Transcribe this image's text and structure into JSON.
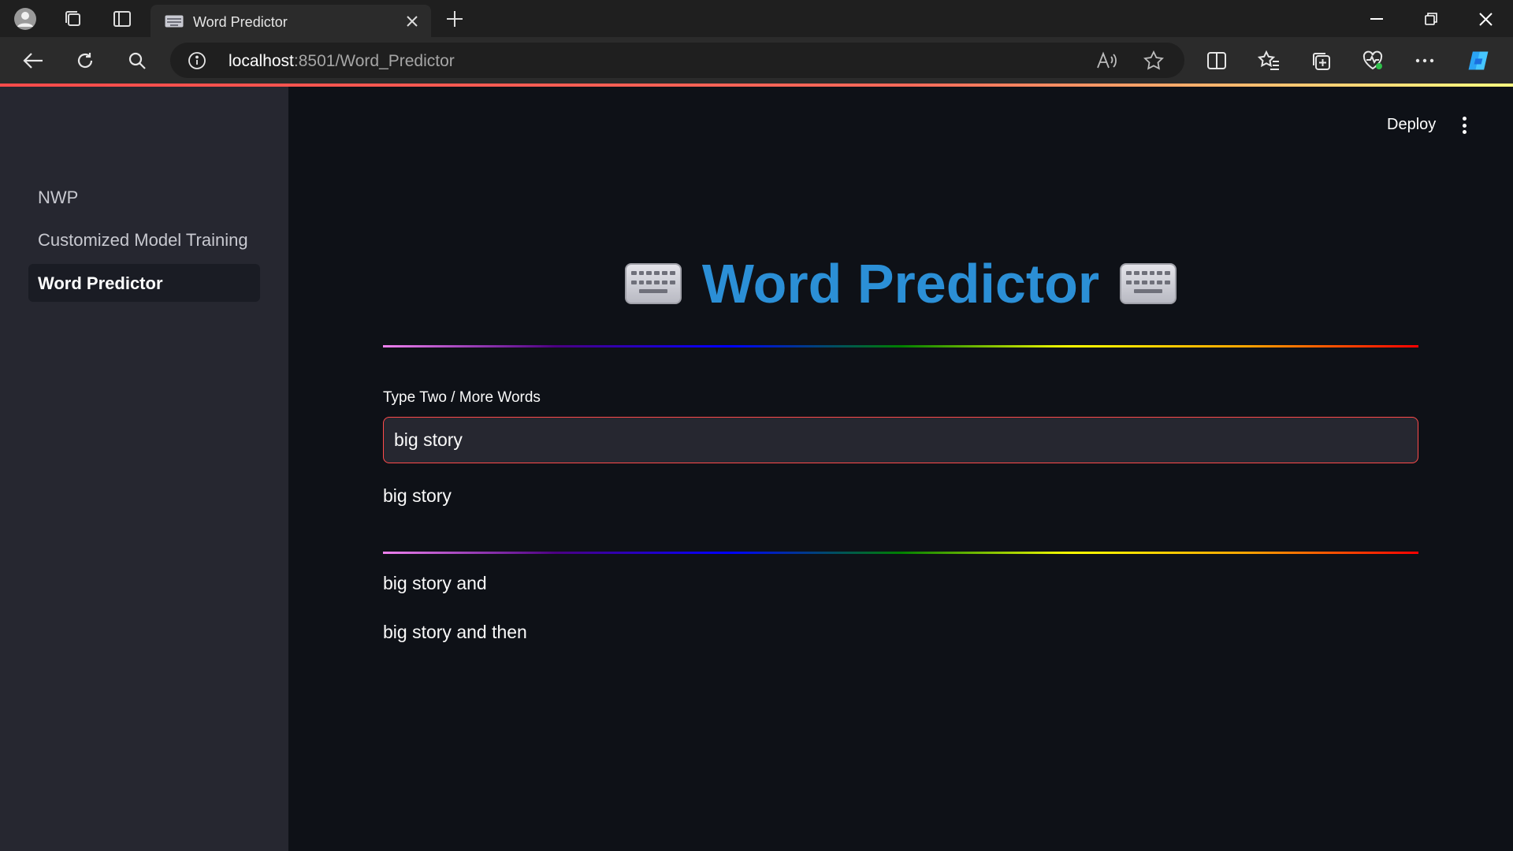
{
  "browser": {
    "tab_title": "Word Predictor",
    "url_host": "localhost",
    "url_rest": ":8501/Word_Predictor"
  },
  "sidebar": {
    "items": [
      {
        "label": "NWP",
        "active": false
      },
      {
        "label": "Customized Model Training",
        "active": false
      },
      {
        "label": "Word Predictor",
        "active": true
      }
    ]
  },
  "header": {
    "deploy_label": "Deploy"
  },
  "main": {
    "title": "Word Predictor",
    "title_icon": "keyboard-icon",
    "input_label": "Type Two / More Words",
    "input_value": "big story",
    "echo_text": "big story",
    "predictions": [
      "big story and",
      "big story and then"
    ]
  },
  "colors": {
    "accent": "#ff4b4b",
    "title": "#2b8fd6",
    "sidebar_bg": "#262730",
    "main_bg": "#0e1117"
  }
}
